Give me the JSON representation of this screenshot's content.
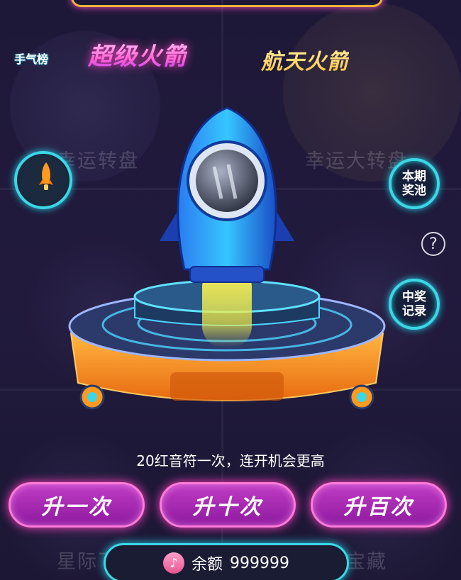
{
  "tabs": {
    "active_label": "超级火箭",
    "inactive_label": "航天火箭"
  },
  "background_labels": {
    "top_left": "幸运转盘",
    "top_right": "幸运大转盘",
    "bottom_left": "星际飞行",
    "bottom_right": "月光宝藏"
  },
  "side_buttons": {
    "rank_label": "手气榜",
    "prize_pool_label": "本期奖池",
    "win_record_label": "中奖记录",
    "help_label": "?"
  },
  "hint_text": "20红音符一次，连开机会更高",
  "actions": {
    "once_label": "升一次",
    "ten_label": "升十次",
    "hundred_label": "升百次"
  },
  "balance": {
    "label": "余额",
    "value": "999999",
    "icon": "music-note-icon"
  },
  "colors": {
    "accent_pink": "#ff3fbf",
    "accent_cyan": "#3bd7e6",
    "gold": "#f0b338"
  }
}
